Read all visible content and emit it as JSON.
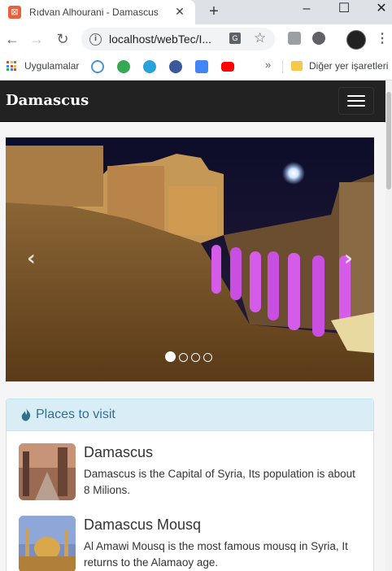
{
  "browser": {
    "tab_title": "Rıdvan Alhourani - Damascus",
    "url": "localhost/webTec/I...",
    "bookmarks": {
      "apps_label": "Uygulamalar",
      "other_label": "Diğer yer işaretleri"
    }
  },
  "site": {
    "brand": "Damascus",
    "carousel": {
      "slide_count": 4,
      "active_slide": 1,
      "prev_glyph": "‹",
      "next_glyph": "›"
    },
    "panel": {
      "title": "Places to visit",
      "items": [
        {
          "title": "Damascus",
          "text": "Damascus is the Capital of Syria, Its population is about 8 Milions."
        },
        {
          "title": "Damascus Mousq",
          "text": "Al Amawi Mousq is the most famous mousq in Syria, It returns to the Alamaoy age."
        }
      ]
    }
  },
  "colors": {
    "navbar_bg": "#222222",
    "panel_heading_bg": "#d9edf7",
    "panel_title": "#31708f"
  }
}
